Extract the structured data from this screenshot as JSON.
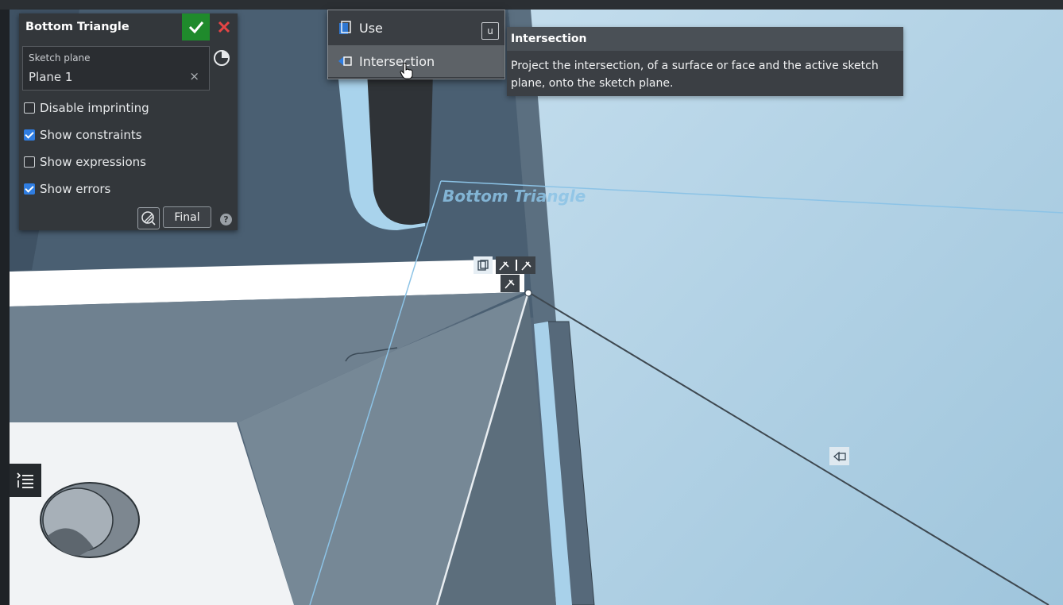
{
  "sketch_dialog": {
    "title": "Bottom Triangle",
    "sketch_plane_label": "Sketch plane",
    "sketch_plane_value": "Plane 1",
    "clear_glyph": "×",
    "options": [
      {
        "label": "Disable imprinting",
        "checked": false
      },
      {
        "label": "Show constraints",
        "checked": true
      },
      {
        "label": "Show expressions",
        "checked": false
      },
      {
        "label": "Show errors",
        "checked": true
      }
    ],
    "final_button": "Final",
    "help_glyph": "?"
  },
  "use_menu": {
    "items": [
      {
        "label": "Use",
        "shortcut": "u",
        "icon": "use-icon"
      },
      {
        "label": "Intersection",
        "icon": "intersection-icon"
      }
    ]
  },
  "tooltip": {
    "title": "Intersection",
    "body": "Project the intersection, of a surface or face and the active sketch plane, onto the sketch plane."
  },
  "viewport": {
    "plane_label": "Bottom Triangle"
  },
  "colors": {
    "confirm": "#1f8a2c",
    "cancel": "#e64545",
    "accent": "#2f7de1",
    "plane": "#a9cfe6"
  }
}
